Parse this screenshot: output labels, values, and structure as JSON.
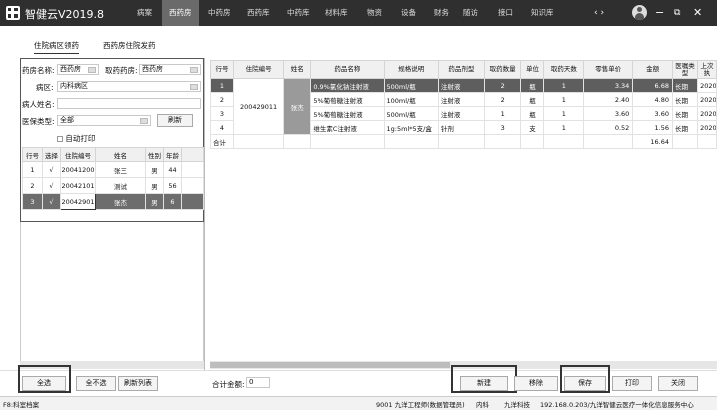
{
  "app": {
    "title": "智健云V2019.8"
  },
  "menu": [
    "病案",
    "西药房",
    "中药房",
    "西药库",
    "中药库",
    "材料库",
    "物资",
    "设备",
    "财务",
    "随访",
    "接口",
    "知识库"
  ],
  "menu_active_index": 1,
  "titlebar": {
    "nav_arrows": "‹ ›"
  },
  "subtabs": [
    "住院病区领药",
    "西药房住院发药"
  ],
  "subtab_active_index": 0,
  "left": {
    "pharmacy_label": "药房名称:",
    "pharmacy_value": "西药房",
    "fetch_pharmacy_label": "取药药房:",
    "fetch_pharmacy_value": "西药房",
    "ward_label": "病区:",
    "ward_value": "内科病区",
    "patient_label": "病人姓名:",
    "patient_value": "",
    "insurance_label": "医保类型:",
    "insurance_value": "全部",
    "refresh": "刷新",
    "auto_print": "自动打印",
    "columns": [
      "行号",
      "选择",
      "住院编号",
      "姓名",
      "性别",
      "年龄"
    ],
    "rows": [
      {
        "no": "1",
        "sel": "√",
        "id": "20041200",
        "name": "张三",
        "sex": "男",
        "age": "44"
      },
      {
        "no": "2",
        "sel": "√",
        "id": "20042101",
        "name": "测试",
        "sex": "男",
        "age": "56"
      },
      {
        "no": "3",
        "sel": "√",
        "id": "20042901",
        "name": "张杰",
        "sex": "男",
        "age": "6"
      }
    ]
  },
  "right": {
    "columns": [
      "行号",
      "住院编号",
      "姓名",
      "药品名称",
      "规格说明",
      "药品剂型",
      "取药数量",
      "单位",
      "取药天数",
      "零售单价",
      "金额",
      "医嘱类型",
      "上次执"
    ],
    "merged_id": "200429011",
    "merged_name": "张杰",
    "rows": [
      {
        "no": "1",
        "drug": "0.9%氯化钠注射液",
        "spec": "500ml/瓶",
        "form": "注射液",
        "qty": "2",
        "unit": "瓶",
        "days": "1",
        "price": "3.34",
        "amount": "6.68",
        "type": "长期",
        "last": "2020-"
      },
      {
        "no": "2",
        "drug": "5%葡萄糖注射液",
        "spec": "100ml/瓶",
        "form": "注射液",
        "qty": "2",
        "unit": "瓶",
        "days": "1",
        "price": "2.40",
        "amount": "4.80",
        "type": "长期",
        "last": "2020-"
      },
      {
        "no": "3",
        "drug": "5%葡萄糖注射液",
        "spec": "500ml/瓶",
        "form": "注射液",
        "qty": "1",
        "unit": "瓶",
        "days": "1",
        "price": "3.60",
        "amount": "3.60",
        "type": "长期",
        "last": "2020-"
      },
      {
        "no": "4",
        "drug": "维生素C注射液",
        "spec": "1g:5ml*5支/盒",
        "form": "针剂",
        "qty": "3",
        "unit": "支",
        "days": "1",
        "price": "0.52",
        "amount": "1.56",
        "type": "长期",
        "last": "2020-"
      }
    ],
    "total_label": "合计",
    "total_amount": "16.64"
  },
  "bottom": {
    "select_all": "全选",
    "deselect_all": "全不选",
    "refresh_list": "刷新列表",
    "total_amount_label": "合计金额:",
    "total_amount_value": "0",
    "new": "新建",
    "delete": "移除",
    "save": "保存",
    "print": "打印",
    "close": "关闭"
  },
  "status": {
    "left": "F8:科室档案",
    "user": "9001 九洋工程师(数据管理员)",
    "dept": "内科",
    "company": "九洋科技",
    "server": "192.168.0.203/九洋智健云医疗一体化信息服务中心"
  }
}
